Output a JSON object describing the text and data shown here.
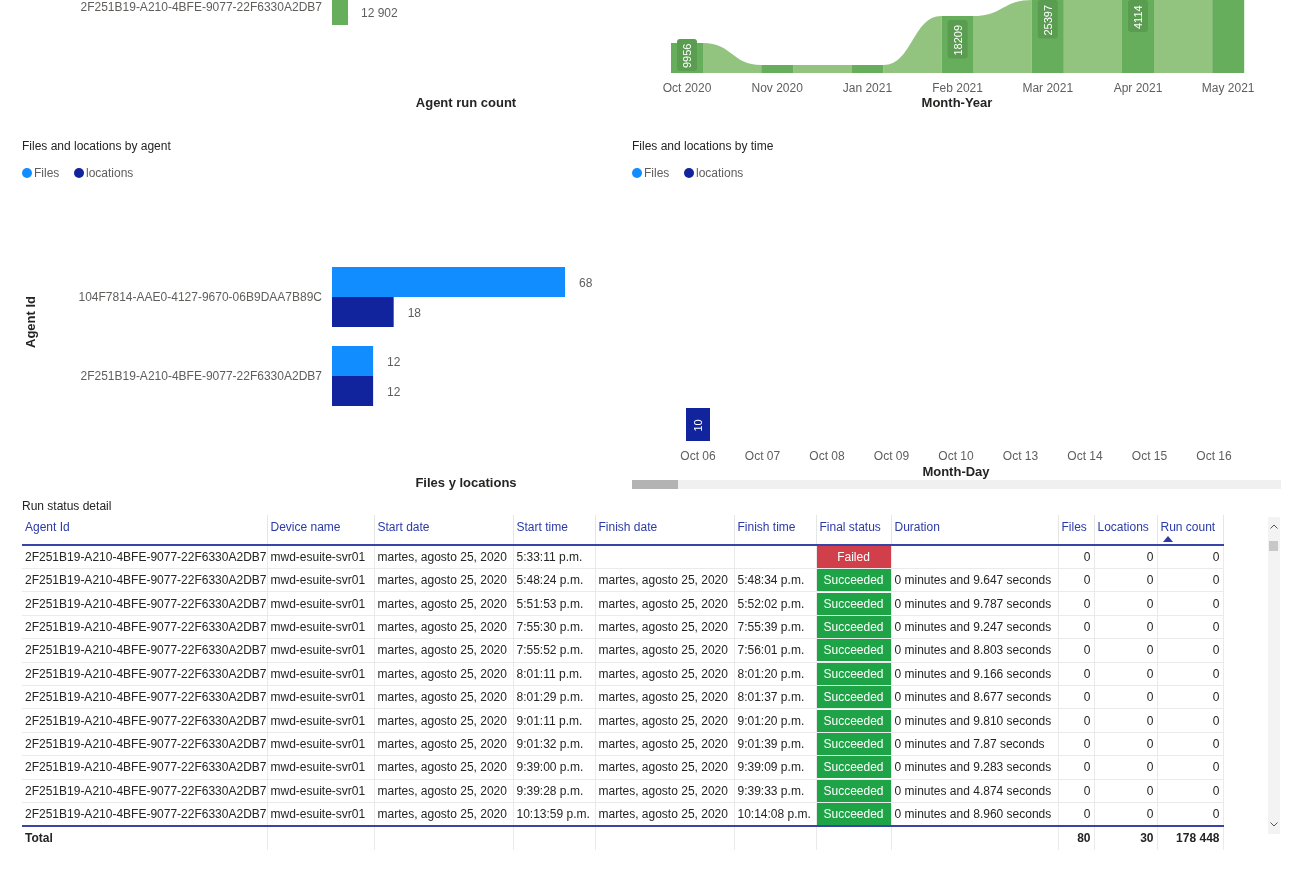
{
  "agent_run_chart": {
    "label": "2F251B19-A210-4BFE-9077-22F6330A2DB7",
    "value_label": "12 902",
    "axis_title": "Agent run count"
  },
  "month_chart": {
    "axis_title": "Month-Year",
    "columns": [
      {
        "label": "Oct 2020",
        "value_label": "9956"
      },
      {
        "label": "Nov 2020"
      },
      {
        "label": "Jan 2021"
      },
      {
        "label": "Feb 2021",
        "value_label": "18209"
      },
      {
        "label": "Mar 2021",
        "value_label": "25397"
      },
      {
        "label": "Apr 2021",
        "value_label": "4114"
      },
      {
        "label": "May 2021"
      }
    ]
  },
  "agent_chart": {
    "chart_data": {
      "type": "bar",
      "orientation": "horizontal",
      "title": "Files and locations by agent",
      "xlabel": "Files y locations",
      "ylabel": "Agent Id",
      "legend": "top-left",
      "categories": [
        "104F7814-AAE0-4127-9670-06B9DAA7B89C",
        "2F251B19-A210-4BFE-9077-22F6330A2DB7"
      ],
      "series": [
        {
          "name": "Files",
          "color": "#118dff",
          "values": [
            68,
            12
          ]
        },
        {
          "name": "locations",
          "color": "#12239e",
          "values": [
            18,
            12
          ]
        }
      ],
      "data_labels": true
    }
  },
  "time_chart": {
    "chart_data": {
      "type": "bar",
      "title": "Files and locations by time",
      "xlabel": "Month-Day",
      "legend": "top-left",
      "categories": [
        "Oct 06",
        "Oct 07",
        "Oct 08",
        "Oct 09",
        "Oct 10",
        "Oct 13",
        "Oct 14",
        "Oct 15",
        "Oct 16"
      ],
      "series": [
        {
          "name": "Files",
          "color": "#118dff",
          "values": [
            null,
            null,
            null,
            null,
            null,
            null,
            null,
            null,
            null
          ]
        },
        {
          "name": "locations",
          "color": "#12239e",
          "values": [
            10,
            null,
            null,
            null,
            null,
            null,
            null,
            null,
            null
          ]
        }
      ],
      "data_labels": true
    }
  },
  "table": {
    "title": "Run status detail",
    "columns": [
      {
        "label": "Agent Id",
        "sorted": false
      },
      {
        "label": "Device name",
        "sorted": false
      },
      {
        "label": "Start date",
        "sorted": false
      },
      {
        "label": "Start time",
        "sorted": false
      },
      {
        "label": "Finish date",
        "sorted": false
      },
      {
        "label": "Finish time",
        "sorted": false
      },
      {
        "label": "Final status",
        "sorted": false
      },
      {
        "label": "Duration",
        "sorted": false
      },
      {
        "label": "Files",
        "sorted": false
      },
      {
        "label": "Locations",
        "sorted": false
      },
      {
        "label": "Run count",
        "sorted": true
      }
    ],
    "rows": [
      {
        "agent": "2F251B19-A210-4BFE-9077-22F6330A2DB7",
        "device": "mwd-esuite-svr01",
        "start_date": "martes, agosto 25, 2020",
        "start_time": "5:33:11 p.m.",
        "status": "Failed",
        "color": "#d13f4a",
        "files": "0",
        "locations": "0",
        "run_count": "0"
      },
      {
        "agent": "2F251B19-A210-4BFE-9077-22F6330A2DB7",
        "device": "mwd-esuite-svr01",
        "start_date": "martes, agosto 25, 2020",
        "start_time": "5:48:24 p.m.",
        "finish_date": "martes, agosto 25, 2020",
        "finish_time": "5:48:34 p.m.",
        "status": "Succeeded",
        "color": "#1ea446",
        "duration": "0 minutes and 9.647 seconds",
        "files": "0",
        "locations": "0",
        "run_count": "0"
      },
      {
        "agent": "2F251B19-A210-4BFE-9077-22F6330A2DB7",
        "device": "mwd-esuite-svr01",
        "start_date": "martes, agosto 25, 2020",
        "start_time": "5:51:53 p.m.",
        "finish_date": "martes, agosto 25, 2020",
        "finish_time": "5:52:02 p.m.",
        "status": "Succeeded",
        "color": "#1ea446",
        "duration": "0 minutes and 9.787 seconds",
        "files": "0",
        "locations": "0",
        "run_count": "0"
      },
      {
        "agent": "2F251B19-A210-4BFE-9077-22F6330A2DB7",
        "device": "mwd-esuite-svr01",
        "start_date": "martes, agosto 25, 2020",
        "start_time": "7:55:30 p.m.",
        "finish_date": "martes, agosto 25, 2020",
        "finish_time": "7:55:39 p.m.",
        "status": "Succeeded",
        "color": "#1ea446",
        "duration": "0 minutes and 9.247 seconds",
        "files": "0",
        "locations": "0",
        "run_count": "0"
      },
      {
        "agent": "2F251B19-A210-4BFE-9077-22F6330A2DB7",
        "device": "mwd-esuite-svr01",
        "start_date": "martes, agosto 25, 2020",
        "start_time": "7:55:52 p.m.",
        "finish_date": "martes, agosto 25, 2020",
        "finish_time": "7:56:01 p.m.",
        "status": "Succeeded",
        "color": "#1ea446",
        "duration": "0 minutes and 8.803 seconds",
        "files": "0",
        "locations": "0",
        "run_count": "0"
      },
      {
        "agent": "2F251B19-A210-4BFE-9077-22F6330A2DB7",
        "device": "mwd-esuite-svr01",
        "start_date": "martes, agosto 25, 2020",
        "start_time": "8:01:11 p.m.",
        "finish_date": "martes, agosto 25, 2020",
        "finish_time": "8:01:20 p.m.",
        "status": "Succeeded",
        "color": "#1ea446",
        "duration": "0 minutes and 9.166 seconds",
        "files": "0",
        "locations": "0",
        "run_count": "0"
      },
      {
        "agent": "2F251B19-A210-4BFE-9077-22F6330A2DB7",
        "device": "mwd-esuite-svr01",
        "start_date": "martes, agosto 25, 2020",
        "start_time": "8:01:29 p.m.",
        "finish_date": "martes, agosto 25, 2020",
        "finish_time": "8:01:37 p.m.",
        "status": "Succeeded",
        "color": "#1ea446",
        "duration": "0 minutes and 8.677 seconds",
        "files": "0",
        "locations": "0",
        "run_count": "0"
      },
      {
        "agent": "2F251B19-A210-4BFE-9077-22F6330A2DB7",
        "device": "mwd-esuite-svr01",
        "start_date": "martes, agosto 25, 2020",
        "start_time": "9:01:11 p.m.",
        "finish_date": "martes, agosto 25, 2020",
        "finish_time": "9:01:20 p.m.",
        "status": "Succeeded",
        "color": "#1ea446",
        "duration": "0 minutes and 9.810 seconds",
        "files": "0",
        "locations": "0",
        "run_count": "0"
      },
      {
        "agent": "2F251B19-A210-4BFE-9077-22F6330A2DB7",
        "device": "mwd-esuite-svr01",
        "start_date": "martes, agosto 25, 2020",
        "start_time": "9:01:32 p.m.",
        "finish_date": "martes, agosto 25, 2020",
        "finish_time": "9:01:39 p.m.",
        "status": "Succeeded",
        "color": "#1ea446",
        "duration": "0 minutes and 7.87 seconds",
        "files": "0",
        "locations": "0",
        "run_count": "0"
      },
      {
        "agent": "2F251B19-A210-4BFE-9077-22F6330A2DB7",
        "device": "mwd-esuite-svr01",
        "start_date": "martes, agosto 25, 2020",
        "start_time": "9:39:00 p.m.",
        "finish_date": "martes, agosto 25, 2020",
        "finish_time": "9:39:09 p.m.",
        "status": "Succeeded",
        "color": "#1ea446",
        "duration": "0 minutes and 9.283 seconds",
        "files": "0",
        "locations": "0",
        "run_count": "0"
      },
      {
        "agent": "2F251B19-A210-4BFE-9077-22F6330A2DB7",
        "device": "mwd-esuite-svr01",
        "start_date": "martes, agosto 25, 2020",
        "start_time": "9:39:28 p.m.",
        "finish_date": "martes, agosto 25, 2020",
        "finish_time": "9:39:33 p.m.",
        "status": "Succeeded",
        "color": "#1ea446",
        "duration": "0 minutes and 4.874 seconds",
        "files": "0",
        "locations": "0",
        "run_count": "0"
      },
      {
        "agent": "2F251B19-A210-4BFE-9077-22F6330A2DB7",
        "device": "mwd-esuite-svr01",
        "start_date": "martes, agosto 25, 2020",
        "start_time": "10:13:59 p.m.",
        "finish_date": "martes, agosto 25, 2020",
        "finish_time": "10:14:08 p.m.",
        "status": "Succeeded",
        "color": "#1ea446",
        "duration": "0 minutes and 8.960 seconds",
        "files": "0",
        "locations": "0",
        "run_count": "0"
      }
    ],
    "total": {
      "label": "Total",
      "files": "80",
      "locations": "30",
      "run_count": "178 448"
    }
  }
}
